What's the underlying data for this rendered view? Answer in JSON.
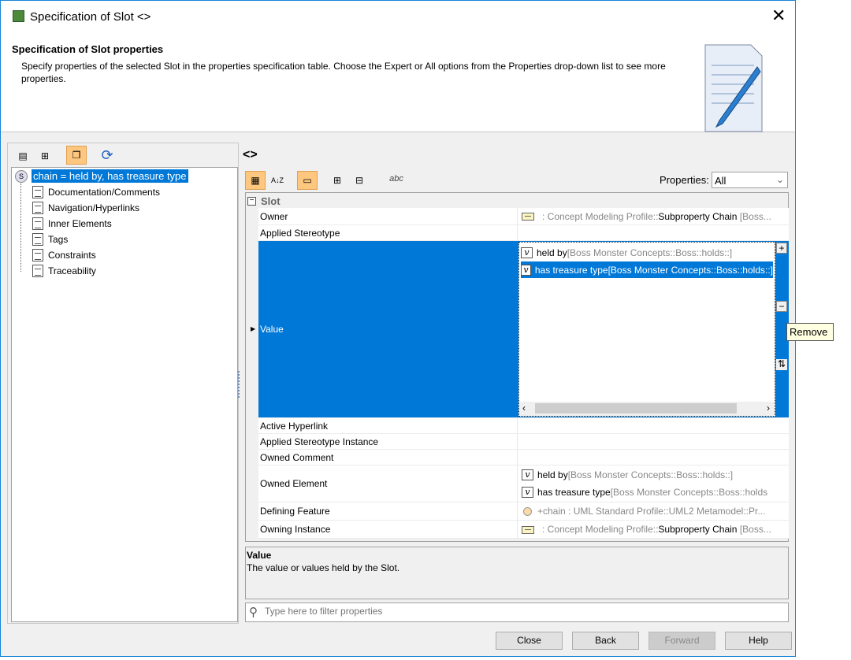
{
  "window": {
    "title": "Specification of Slot <>",
    "close_icon": "close-icon"
  },
  "header": {
    "title": "Specification of Slot properties",
    "description": "Specify properties of the selected Slot in the properties specification table. Choose the Expert or All options from the Properties drop-down list to see more properties."
  },
  "left": {
    "tree_root": "chain = held by, has treasure type",
    "items": [
      "Documentation/Comments",
      "Navigation/Hyperlinks",
      "Inner Elements",
      "Tags",
      "Constraints",
      "Traceability"
    ]
  },
  "right": {
    "element_name": "<>",
    "properties_label": "Properties:",
    "properties_value": "All",
    "abc_label": "abc"
  },
  "table": {
    "group": "Slot",
    "owner": {
      "name": "Owner",
      "prefix": ": Concept Modeling Profile::",
      "main": "Subproperty Chain",
      "suffix": " [Boss..."
    },
    "applied_stereotype": "Applied Stereotype",
    "value": {
      "name": "Value",
      "items": [
        {
          "name": "held by",
          "path": " [Boss Monster Concepts::Boss::holds::]"
        },
        {
          "name": "has treasure type",
          "path": " [Boss Monster Concepts::Boss::holds::]"
        }
      ],
      "tooltip": "Remove"
    },
    "active_hyperlink": "Active Hyperlink",
    "applied_stereotype_instance": "Applied Stereotype Instance",
    "owned_comment": "Owned Comment",
    "owned_element": {
      "name": "Owned Element",
      "items": [
        {
          "name": "held by",
          "path": " [Boss Monster Concepts::Boss::holds::]"
        },
        {
          "name": "has treasure type",
          "path": " [Boss Monster Concepts::Boss::holds"
        }
      ]
    },
    "defining_feature": {
      "name": "Defining Feature",
      "value": "+chain : UML Standard Profile::UML2 Metamodel::Pr..."
    },
    "owning_instance": {
      "name": "Owning Instance",
      "prefix": ": Concept Modeling Profile::",
      "main": "Subproperty Chain",
      "suffix": " [Boss..."
    }
  },
  "description": {
    "title": "Value",
    "text": "The value or values held by the Slot."
  },
  "filter": {
    "placeholder": "Type here to filter properties"
  },
  "buttons": {
    "close": "Close",
    "back": "Back",
    "forward": "Forward",
    "help": "Help"
  },
  "colors": {
    "selection": "#0078d7",
    "accent_toggle": "#fdc77f"
  }
}
